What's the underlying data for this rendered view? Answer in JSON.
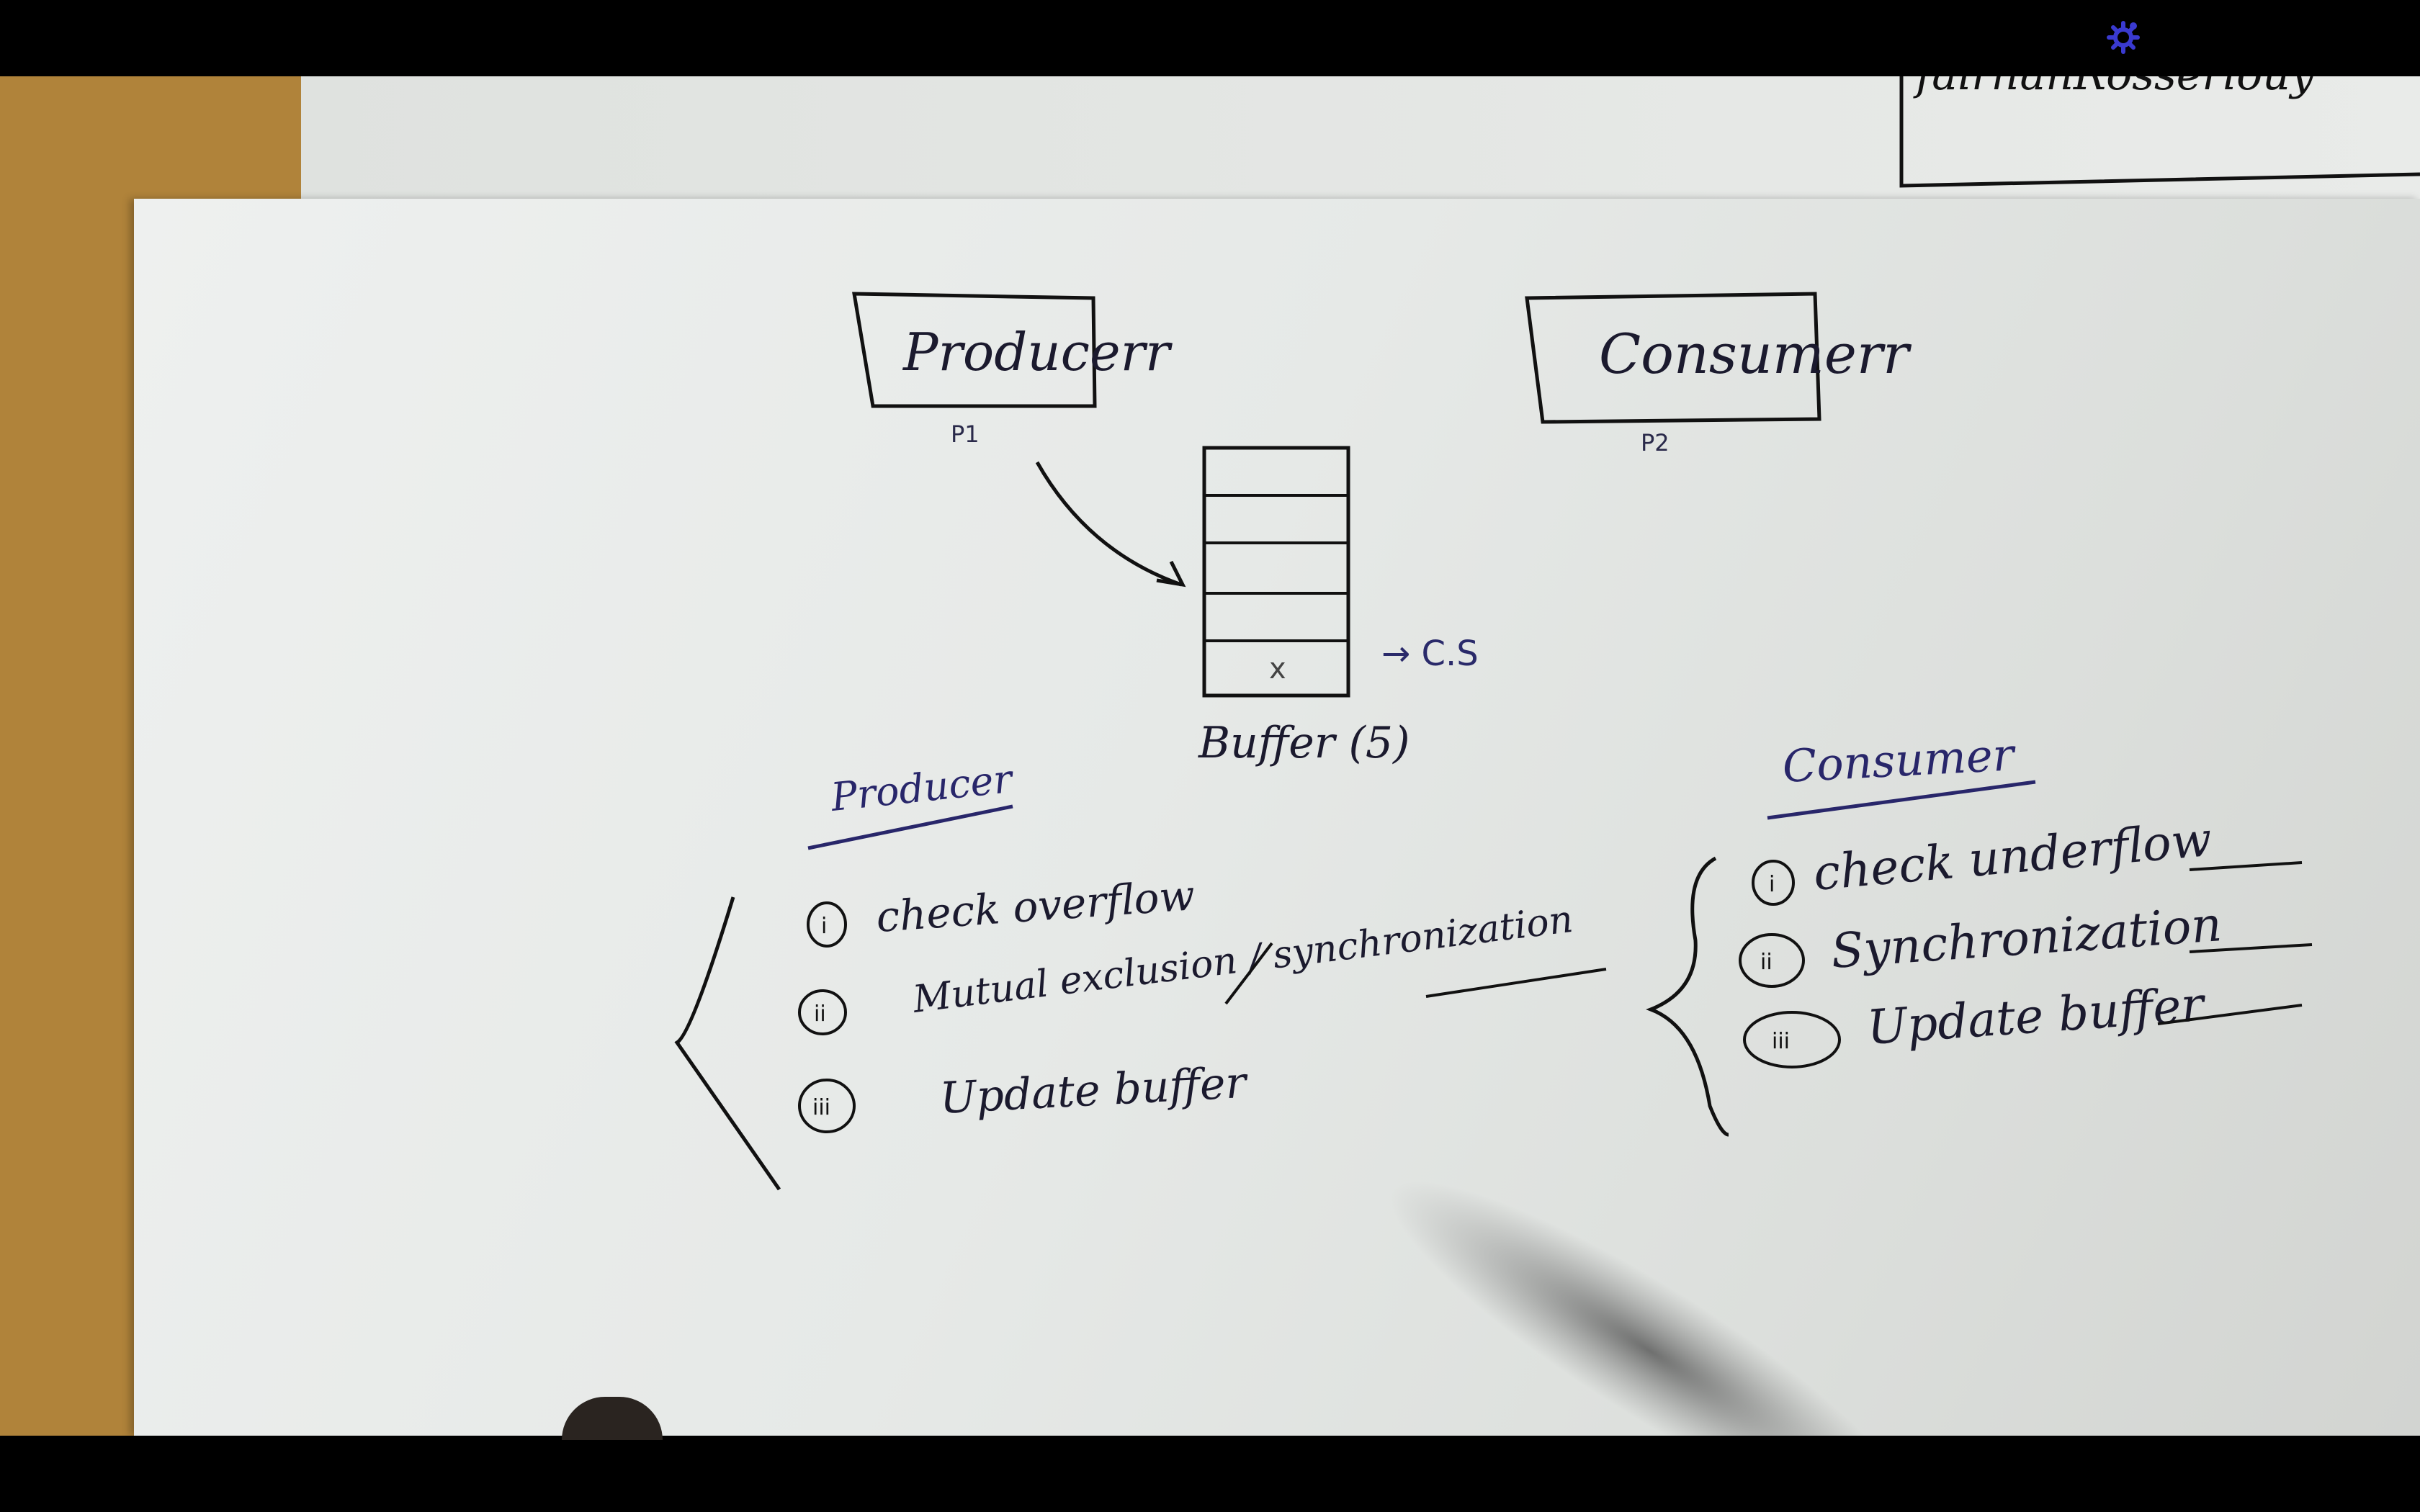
{
  "player": {
    "settings_icon": "gear-icon",
    "settings_color": "#3a3ad0"
  },
  "whiteboard": {
    "corner_note": "fairhanRosseriouy",
    "producer_box": {
      "label": "Producerr",
      "pid": "P1"
    },
    "consumer_box": {
      "label": "Consumerr",
      "pid": "P2"
    },
    "buffer": {
      "label": "Buffer (5)",
      "slot_mark": "x",
      "cs_label": "→ C.S"
    },
    "producer_section": {
      "heading": "Producer",
      "items": [
        {
          "num": "i",
          "text": "check overflow"
        },
        {
          "num": "ii",
          "text": "Mutual exclusion / synchronization"
        },
        {
          "num": "iii",
          "text": "Update buffer"
        }
      ]
    },
    "consumer_section": {
      "heading": "Consumer",
      "items": [
        {
          "num": "i",
          "text": "check underflow"
        },
        {
          "num": "ii",
          "text": "Synchronization"
        },
        {
          "num": "iii",
          "text": "Update buffer"
        }
      ]
    },
    "ink_color": "#1b1a2e",
    "heading_ink_color": "#28266a"
  }
}
